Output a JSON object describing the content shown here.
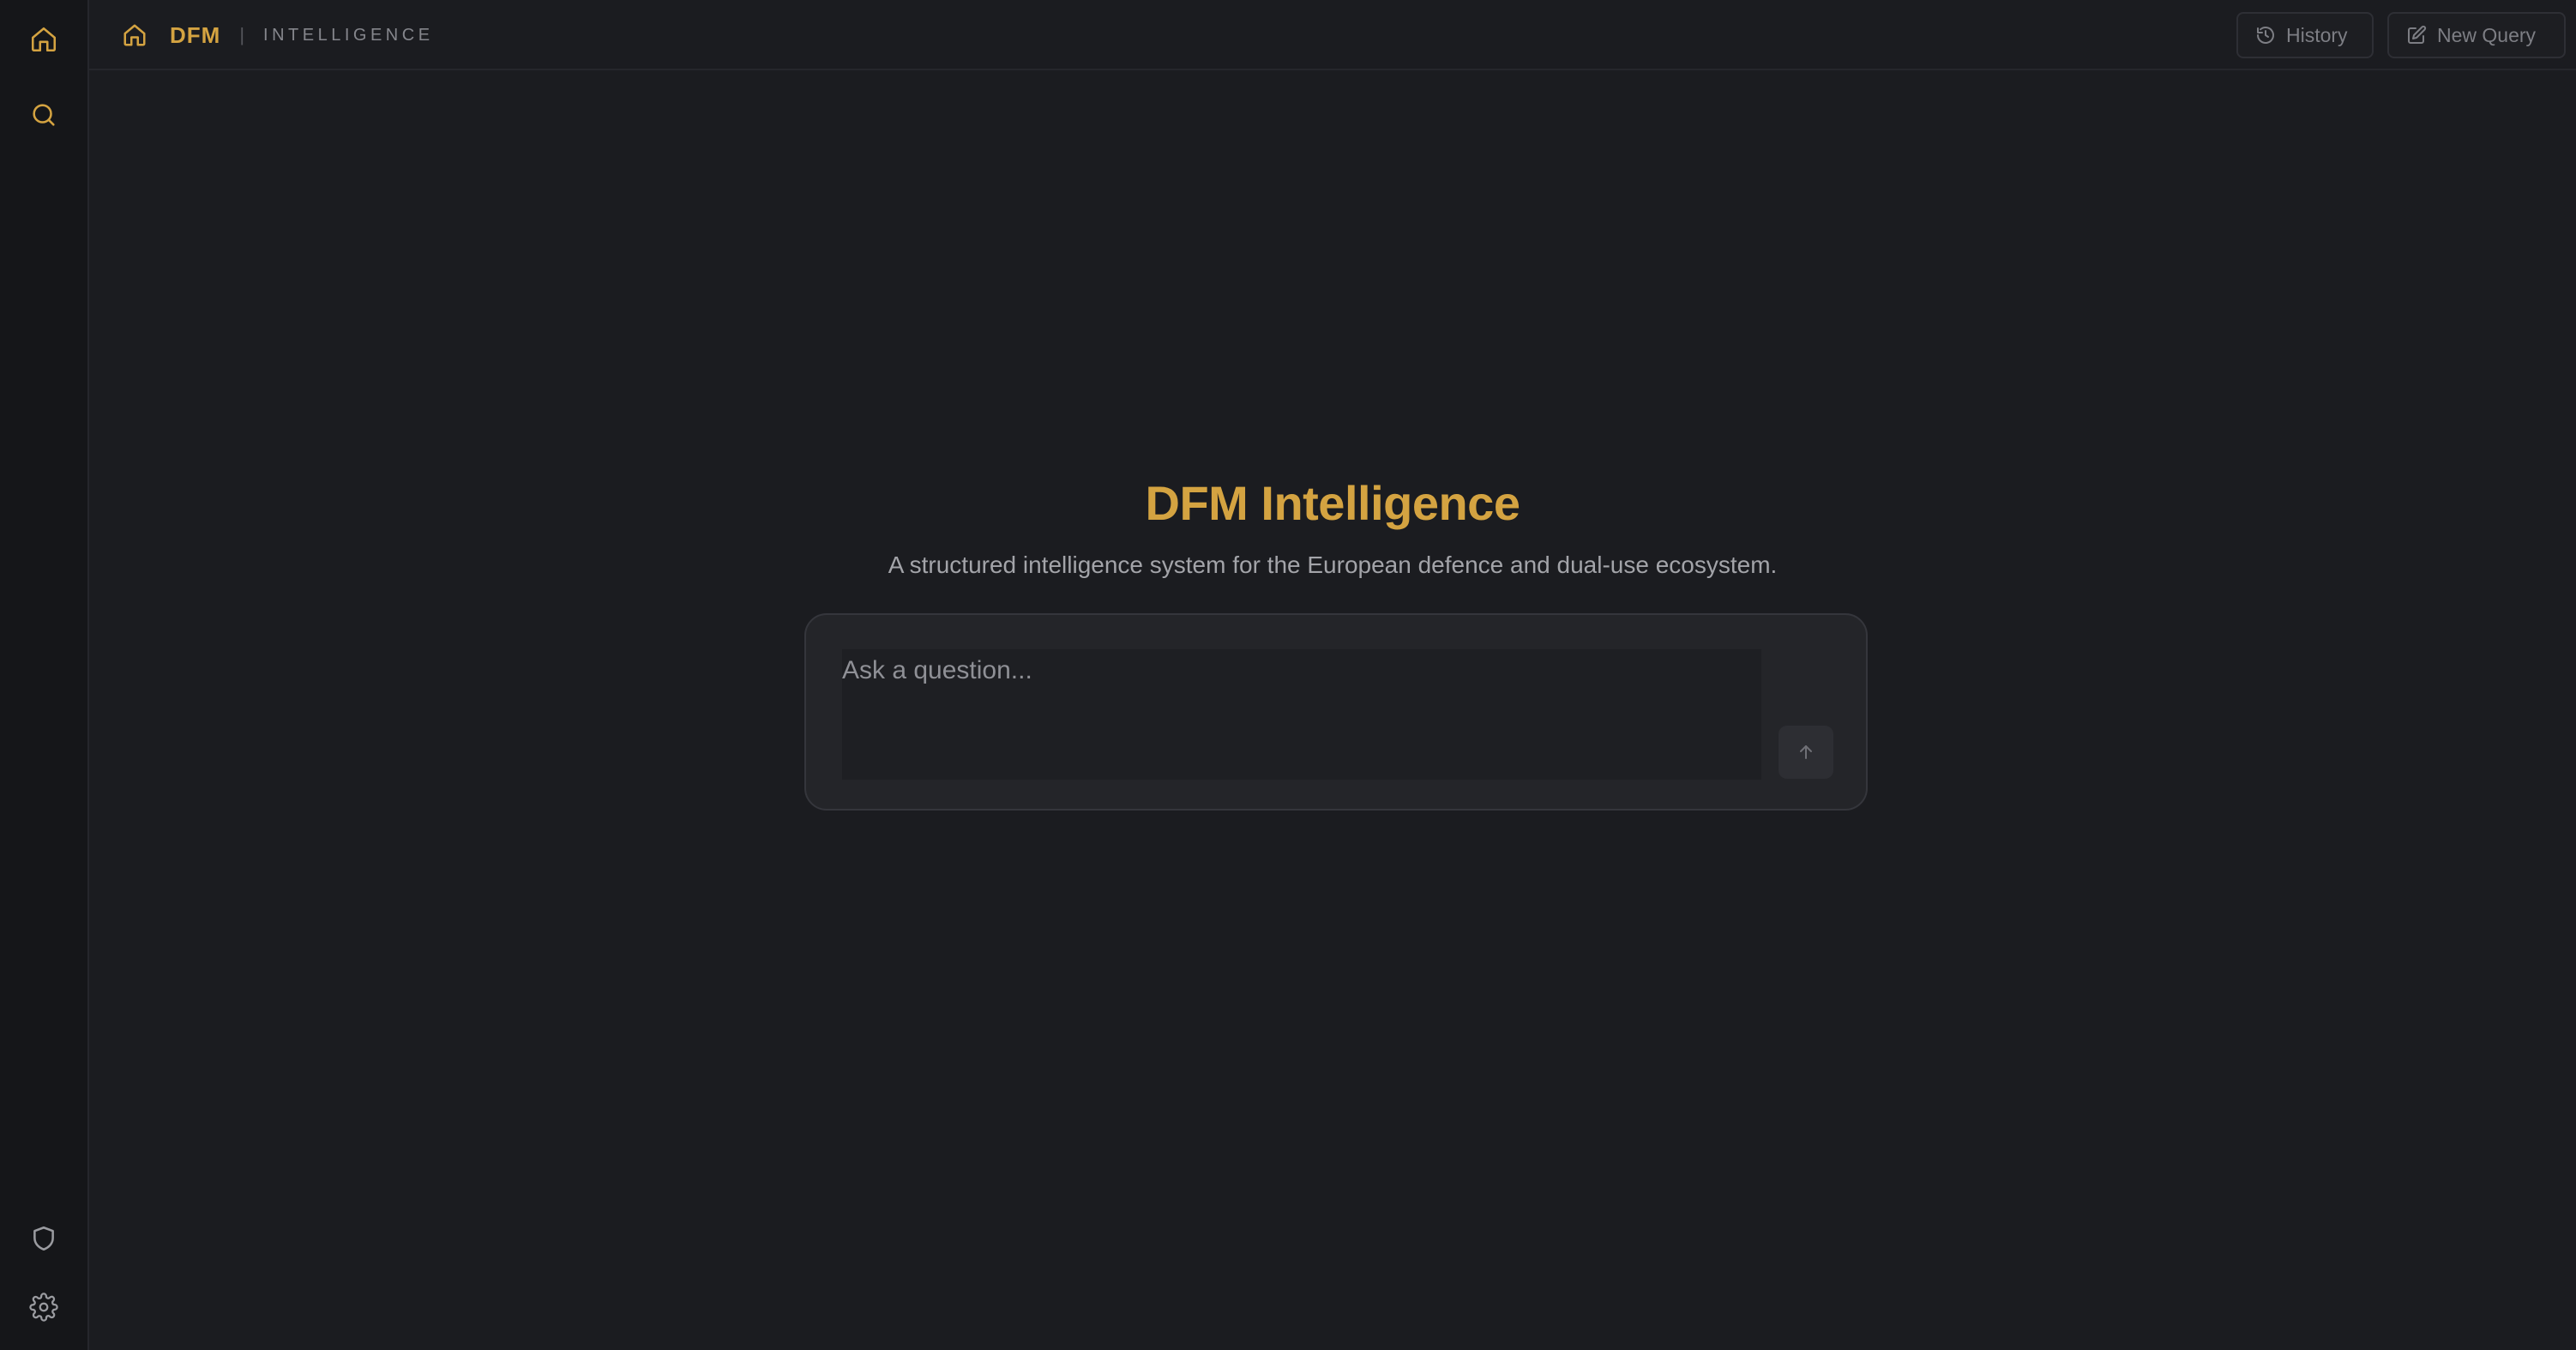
{
  "colors": {
    "accent": "#d4a341",
    "background": "#1b1c20",
    "rail": "#151619",
    "muted_text": "#85868c"
  },
  "sidebar": {
    "items": [
      {
        "name": "home",
        "icon": "home-icon",
        "active": true
      },
      {
        "name": "search",
        "icon": "search-icon",
        "active": false
      },
      {
        "name": "security",
        "icon": "shield-icon",
        "active": false
      },
      {
        "name": "settings",
        "icon": "gear-icon",
        "active": false
      }
    ]
  },
  "header": {
    "home_icon": "home-icon",
    "brand": "DFM",
    "separator": "|",
    "section": "INTELLIGENCE",
    "history_label": "History",
    "history_icon": "history-icon",
    "new_query_label": "New Query",
    "new_query_icon": "edit-icon"
  },
  "main": {
    "title": "DFM Intelligence",
    "subtitle": "A structured intelligence system for the European defence and dual-use ecosystem.",
    "input_placeholder": "Ask a question...",
    "input_value": "",
    "send_icon": "arrow-up-icon"
  }
}
